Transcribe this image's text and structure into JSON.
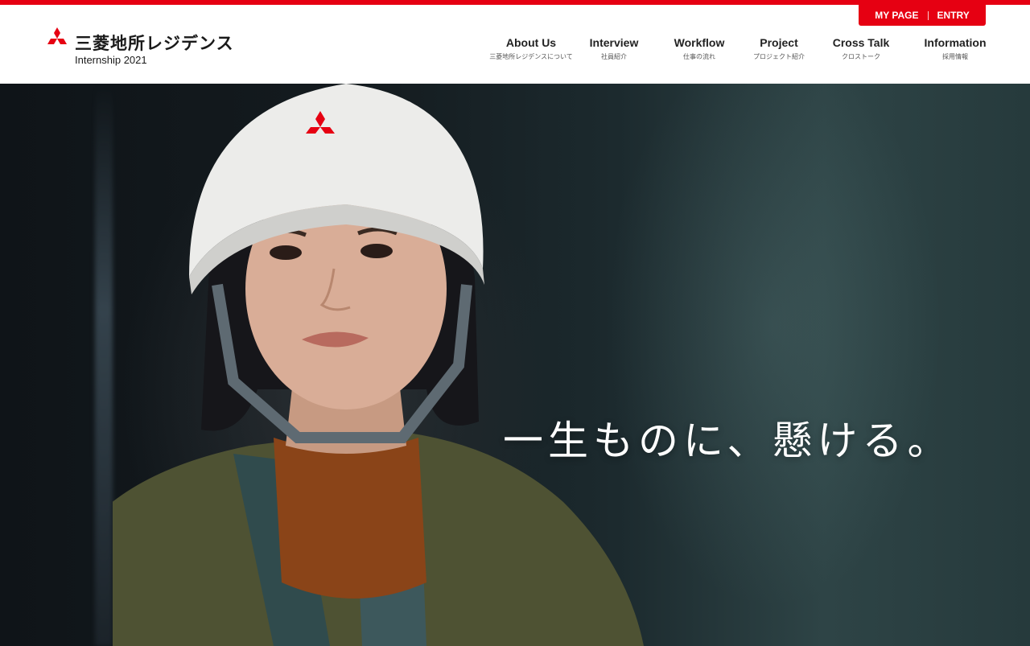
{
  "brand": {
    "name_jp": "三菱地所レジデンス",
    "sub": "Internship 2021",
    "accent": "#e60012"
  },
  "util_nav": {
    "my_page": "MY PAGE",
    "entry": "ENTRY"
  },
  "nav": {
    "items": [
      {
        "label": "About Us",
        "sub": "三菱地所レジデンスについて"
      },
      {
        "label": "Interview",
        "sub": "社員紹介"
      },
      {
        "label": "Workflow",
        "sub": "仕事の流れ"
      },
      {
        "label": "Project",
        "sub": "プロジェクト紹介"
      },
      {
        "label": "Cross Talk",
        "sub": "クロストーク"
      },
      {
        "label": "Information",
        "sub": "採用情報"
      }
    ]
  },
  "hero": {
    "catch_copy": "一生ものに、懸ける。",
    "image": "woman-in-hard-hat-photo"
  }
}
